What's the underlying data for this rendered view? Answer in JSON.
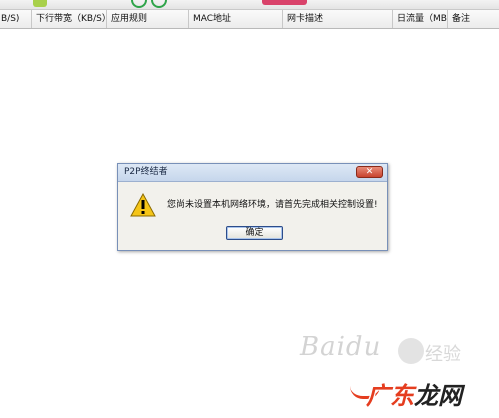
{
  "table": {
    "columns": [
      "B/S)",
      "下行带宽（KB/S）",
      "应用规则",
      "MAC地址",
      "网卡描述",
      "日流量（MB）",
      "备注"
    ]
  },
  "dialog": {
    "title": "P2P终结者",
    "close_label": "✕",
    "message": "您尚未设置本机网络环境，请首先完成相关控制设置!",
    "ok_label": "确定",
    "icon": "warning-icon"
  },
  "watermark": {
    "baidu": "Baidu",
    "jingyan": "经验",
    "site_prefix": "广东",
    "site_suffix": "龙网"
  },
  "colors": {
    "dialog_border": "#7890b8",
    "close_red": "#c8432e",
    "warning_yellow": "#f5c518",
    "watermark_red": "#e53d1f"
  }
}
